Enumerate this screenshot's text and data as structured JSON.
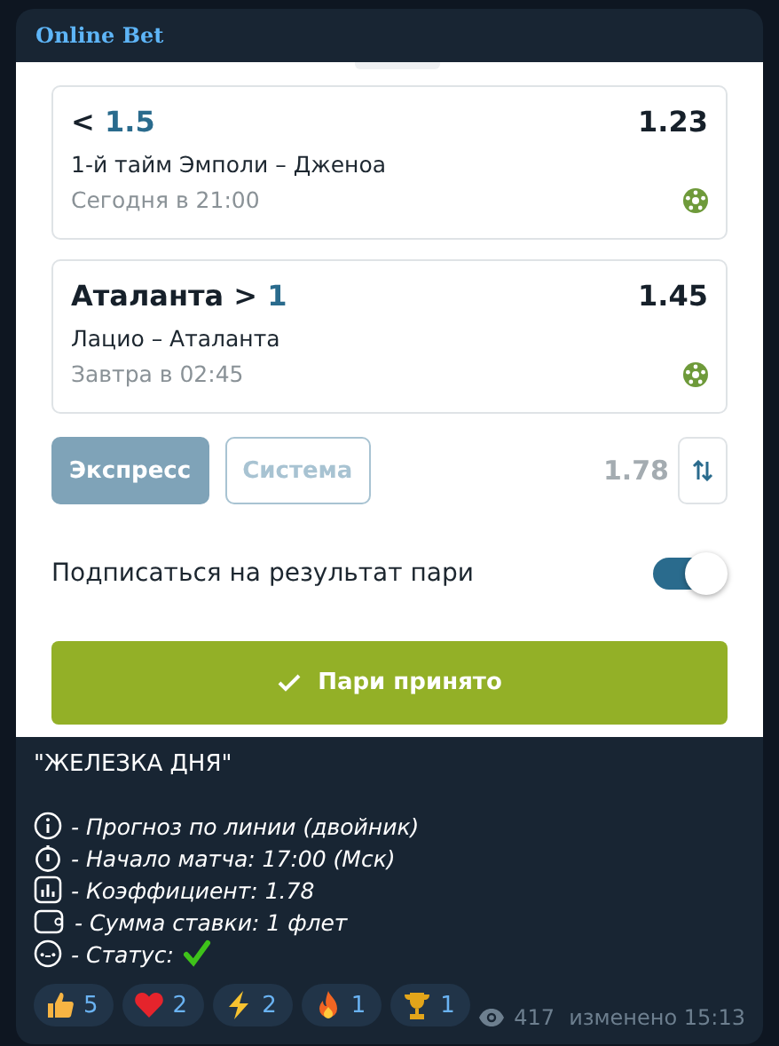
{
  "channel": {
    "name": "Online Bet"
  },
  "bets": [
    {
      "pick_label": "<",
      "pick_value": "1.5",
      "odds": "1.23",
      "match": "1-й тайм Эмполи – Дженоа",
      "time": "Сегодня в 21:00"
    },
    {
      "pick_label": "Аталанта >",
      "pick_value": "1",
      "odds": "1.45",
      "match": "Лацио – Аталанта",
      "time": "Завтра в 02:45"
    }
  ],
  "bet_types": [
    {
      "label": "Экспресс",
      "selected": true
    },
    {
      "label": "Система",
      "selected": false
    }
  ],
  "total_odds": "1.78",
  "subscribe": {
    "label": "Подписаться на результат пари",
    "on": true
  },
  "confirm_button": "Пари принято",
  "caption": {
    "title": "\"ЖЕЛЕЗКА ДНЯ\"",
    "lines": [
      {
        "kind": "info",
        "text": "- Прогноз по линии (двойник)"
      },
      {
        "kind": "stopwatch",
        "text": "- Начало матча: 17:00 (Мск)"
      },
      {
        "kind": "chart",
        "text": "- Коэффициент: 1.78"
      },
      {
        "kind": "wallet",
        "text": "- Сумма ставки: 1 флет"
      },
      {
        "kind": "status",
        "text": "- Статус:",
        "check": true
      }
    ]
  },
  "reactions": [
    {
      "kind": "thumbs",
      "count": "5"
    },
    {
      "kind": "heart",
      "count": "2"
    },
    {
      "kind": "bolt",
      "count": "2"
    },
    {
      "kind": "fire",
      "count": "1"
    },
    {
      "kind": "trophy",
      "count": "1"
    }
  ],
  "views": "417",
  "edited": "изменено 15:13"
}
